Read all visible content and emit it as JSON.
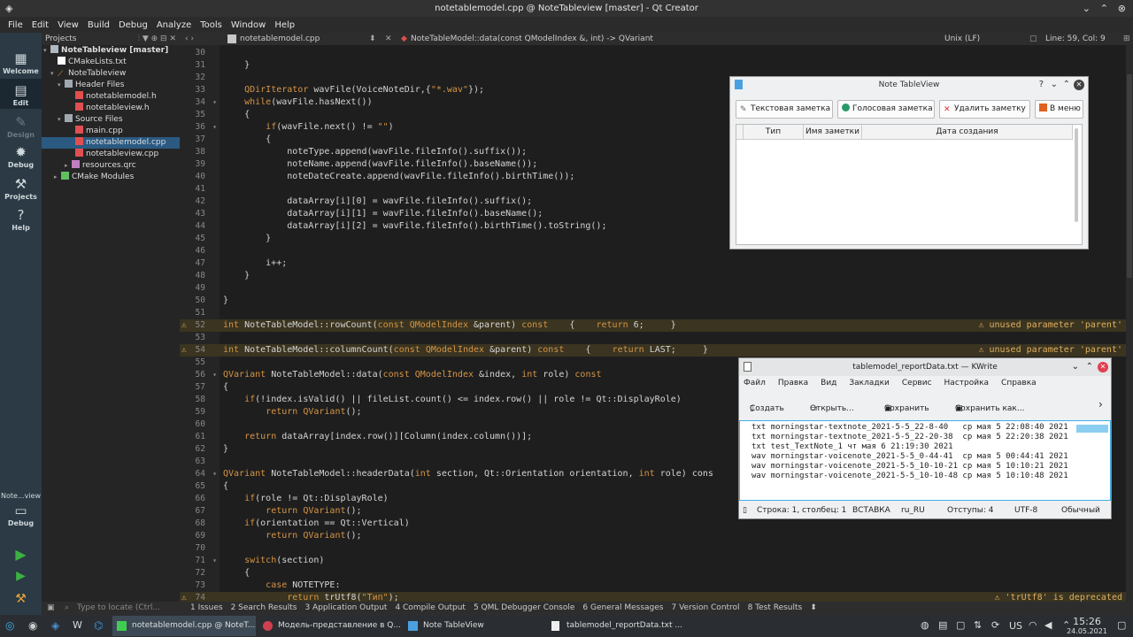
{
  "window": {
    "title": "notetablemodel.cpp @ NoteTableview [master] - Qt Creator"
  },
  "menu": [
    "File",
    "Edit",
    "View",
    "Build",
    "Debug",
    "Analyze",
    "Tools",
    "Window",
    "Help"
  ],
  "modes": [
    {
      "label": "Welcome",
      "icon": "grid-icon"
    },
    {
      "label": "Edit",
      "icon": "edit-icon"
    },
    {
      "label": "Design",
      "icon": "design-icon"
    },
    {
      "label": "Debug",
      "icon": "bug-icon"
    },
    {
      "label": "Projects",
      "icon": "wrench-icon"
    },
    {
      "label": "Help",
      "icon": "help-icon"
    }
  ],
  "kit": {
    "name": "Note...view",
    "mode": "Debug"
  },
  "project": {
    "header": "Projects",
    "tree": [
      "NoteTableview [master]",
      "CMakeLists.txt",
      "NoteTableview",
      "Header Files",
      "notetablemodel.h",
      "notetableview.h",
      "Source Files",
      "main.cpp",
      "notetablemodel.cpp",
      "notetableview.cpp",
      "resources.qrc",
      "CMake Modules"
    ]
  },
  "editor": {
    "file": "notetablemodel.cpp",
    "symbol": "NoteTableModel::data(const QModelIndex &, int) -> QVariant",
    "line_ending": "Unix (LF)",
    "position": "Line: 59, Col: 9",
    "line_numbers": [
      "30",
      "31",
      "32",
      "33",
      "34",
      "35",
      "36",
      "37",
      "38",
      "39",
      "40",
      "41",
      "42",
      "43",
      "44",
      "45",
      "46",
      "47",
      "48",
      "49",
      "50",
      "51",
      "52",
      "53",
      "54",
      "55",
      "56",
      "57",
      "58",
      "59",
      "60",
      "61",
      "62",
      "63",
      "64",
      "65",
      "66",
      "67",
      "68",
      "69",
      "70",
      "71",
      "72",
      "73",
      "74"
    ],
    "lines": [
      "",
      "    }",
      "",
      "    QDirIterator wavFile(VoiceNoteDir,{\"*.wav\"});",
      "    while(wavFile.hasNext())",
      "    {",
      "        if(wavFile.next() != \"\")",
      "        {",
      "            noteType.append(wavFile.fileInfo().suffix());",
      "            noteName.append(wavFile.fileInfo().baseName());",
      "            noteDateCreate.append(wavFile.fileInfo().birthTime());",
      "",
      "            dataArray[i][0] = wavFile.fileInfo().suffix();",
      "            dataArray[i][1] = wavFile.fileInfo().baseName();",
      "            dataArray[i][2] = wavFile.fileInfo().birthTime().toString();",
      "        }",
      "",
      "        i++;",
      "    }",
      "",
      "}",
      "",
      "int NoteTableModel::rowCount(const QModelIndex &parent) const    {    return 6;     }",
      "",
      "int NoteTableModel::columnCount(const QModelIndex &parent) const    {    return LAST;     }",
      "",
      "QVariant NoteTableModel::data(const QModelIndex &index, int role) const",
      "{",
      "    if(!index.isValid() || fileList.count() <= index.row() || role != Qt::DisplayRole)",
      "        return QVariant();",
      "",
      "    return dataArray[index.row()][Column(index.column())];",
      "}",
      "",
      "QVariant NoteTableModel::headerData(int section, Qt::Orientation orientation, int role) cons",
      "{",
      "    if(role != Qt::DisplayRole)",
      "        return QVariant();",
      "    if(orientation == Qt::Vertical)",
      "        return QVariant();",
      "",
      "    switch(section)",
      "    {",
      "        case NOTETYPE:",
      "            return trUtf8(\"Тип\");"
    ],
    "warnings": [
      {
        "line": "52",
        "text": "unused parameter 'parent'"
      },
      {
        "line": "54",
        "text": "unused parameter 'parent'"
      },
      {
        "line": "74",
        "text": "'trUtf8' is deprecated"
      }
    ]
  },
  "output_tabs": [
    "1 Issues",
    "2 Search Results",
    "3 Application Output",
    "4 Compile Output",
    "5 QML Debugger Console",
    "6 General Messages",
    "7 Version Control",
    "8 Test Results"
  ],
  "locator_placeholder": "Type to locate (Ctrl...",
  "note_window": {
    "title": "Note TableView",
    "buttons": [
      "Текстовая заметка",
      "Голосовая заметка",
      "Удалить заметку",
      "В меню"
    ],
    "columns": [
      "Тип",
      "Имя заметки",
      "Дата создания"
    ]
  },
  "kwrite": {
    "title": "tablemodel_reportData.txt — KWrite",
    "menu": [
      "Файл",
      "Правка",
      "Вид",
      "Закладки",
      "Сервис",
      "Настройка",
      "Справка"
    ],
    "toolbar": [
      "Создать",
      "Открыть...",
      "Сохранить",
      "Сохранить как..."
    ],
    "lines": [
      "txt morningstar-textnote_2021-5-5_22-8-40   ср мая 5 22:08:40 2021",
      "txt morningstar-textnote_2021-5-5_22-20-38  ср мая 5 22:20:38 2021",
      "txt test_TextNote_1 чт мая 6 21:19:30 2021",
      "wav morningstar-voicenote_2021-5-5_0-44-41  ср мая 5 00:44:41 2021",
      "wav morningstar-voicenote_2021-5-5_10-10-21 ср мая 5 10:10:21 2021",
      "wav morningstar-voicenote_2021-5-5_10-10-48 ср мая 5 10:10:48 2021"
    ],
    "status": {
      "cursor": "Строка: 1, столбец: 1",
      "mode": "ВСТАВКА",
      "lang": "ru_RU",
      "indent": "Отступы: 4",
      "encoding": "UTF-8",
      "highlight": "Обычный"
    }
  },
  "taskbar": {
    "tasks": [
      "notetablemodel.cpp @ NoteT...",
      "Модель-представление в Q...",
      "Note TableView",
      "tablemodel_reportData.txt ..."
    ],
    "lang": "US",
    "time": "15:26",
    "date": "24.05.2021"
  }
}
